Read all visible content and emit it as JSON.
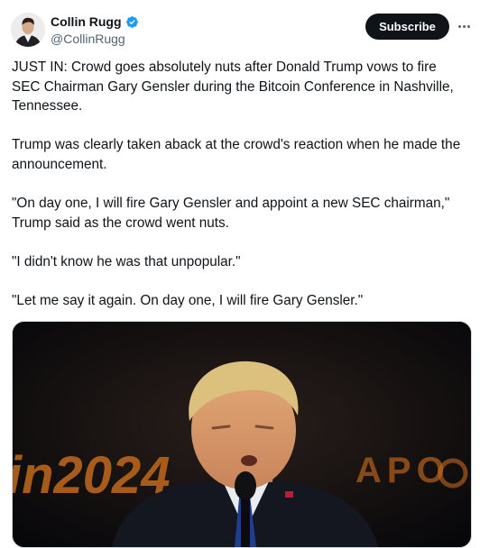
{
  "author": {
    "display_name": "Collin Rugg",
    "handle": "@CollinRugg",
    "verified": true,
    "verified_color": "#1d9bf0"
  },
  "actions": {
    "subscribe_label": "Subscribe",
    "more_icon": "more-horizontal-icon"
  },
  "tweet": {
    "paragraphs": [
      "JUST IN: Crowd goes absolutely nuts after Donald Trump vows to fire SEC Chairman Gary Gensler during the Bitcoin Conference in Nashville, Tennessee.",
      "Trump was clearly taken aback at the crowd's reaction when he made the announcement.",
      "\"On day one, I will fire Gary Gensler and appoint a new SEC chairman,\" Trump said as the crowd went nuts.",
      "\"I didn't know he was that unpopular.\"",
      "\"Let me say it again. On day one, I will fire Gary Gensler.\""
    ]
  },
  "media": {
    "backdrop_text_left": "in2024",
    "backdrop_text_right": "APO"
  },
  "colors": {
    "text": "#0f1419",
    "secondary": "#536471",
    "accent": "#1d9bf0",
    "backdrop_orange": "#c2691c"
  }
}
